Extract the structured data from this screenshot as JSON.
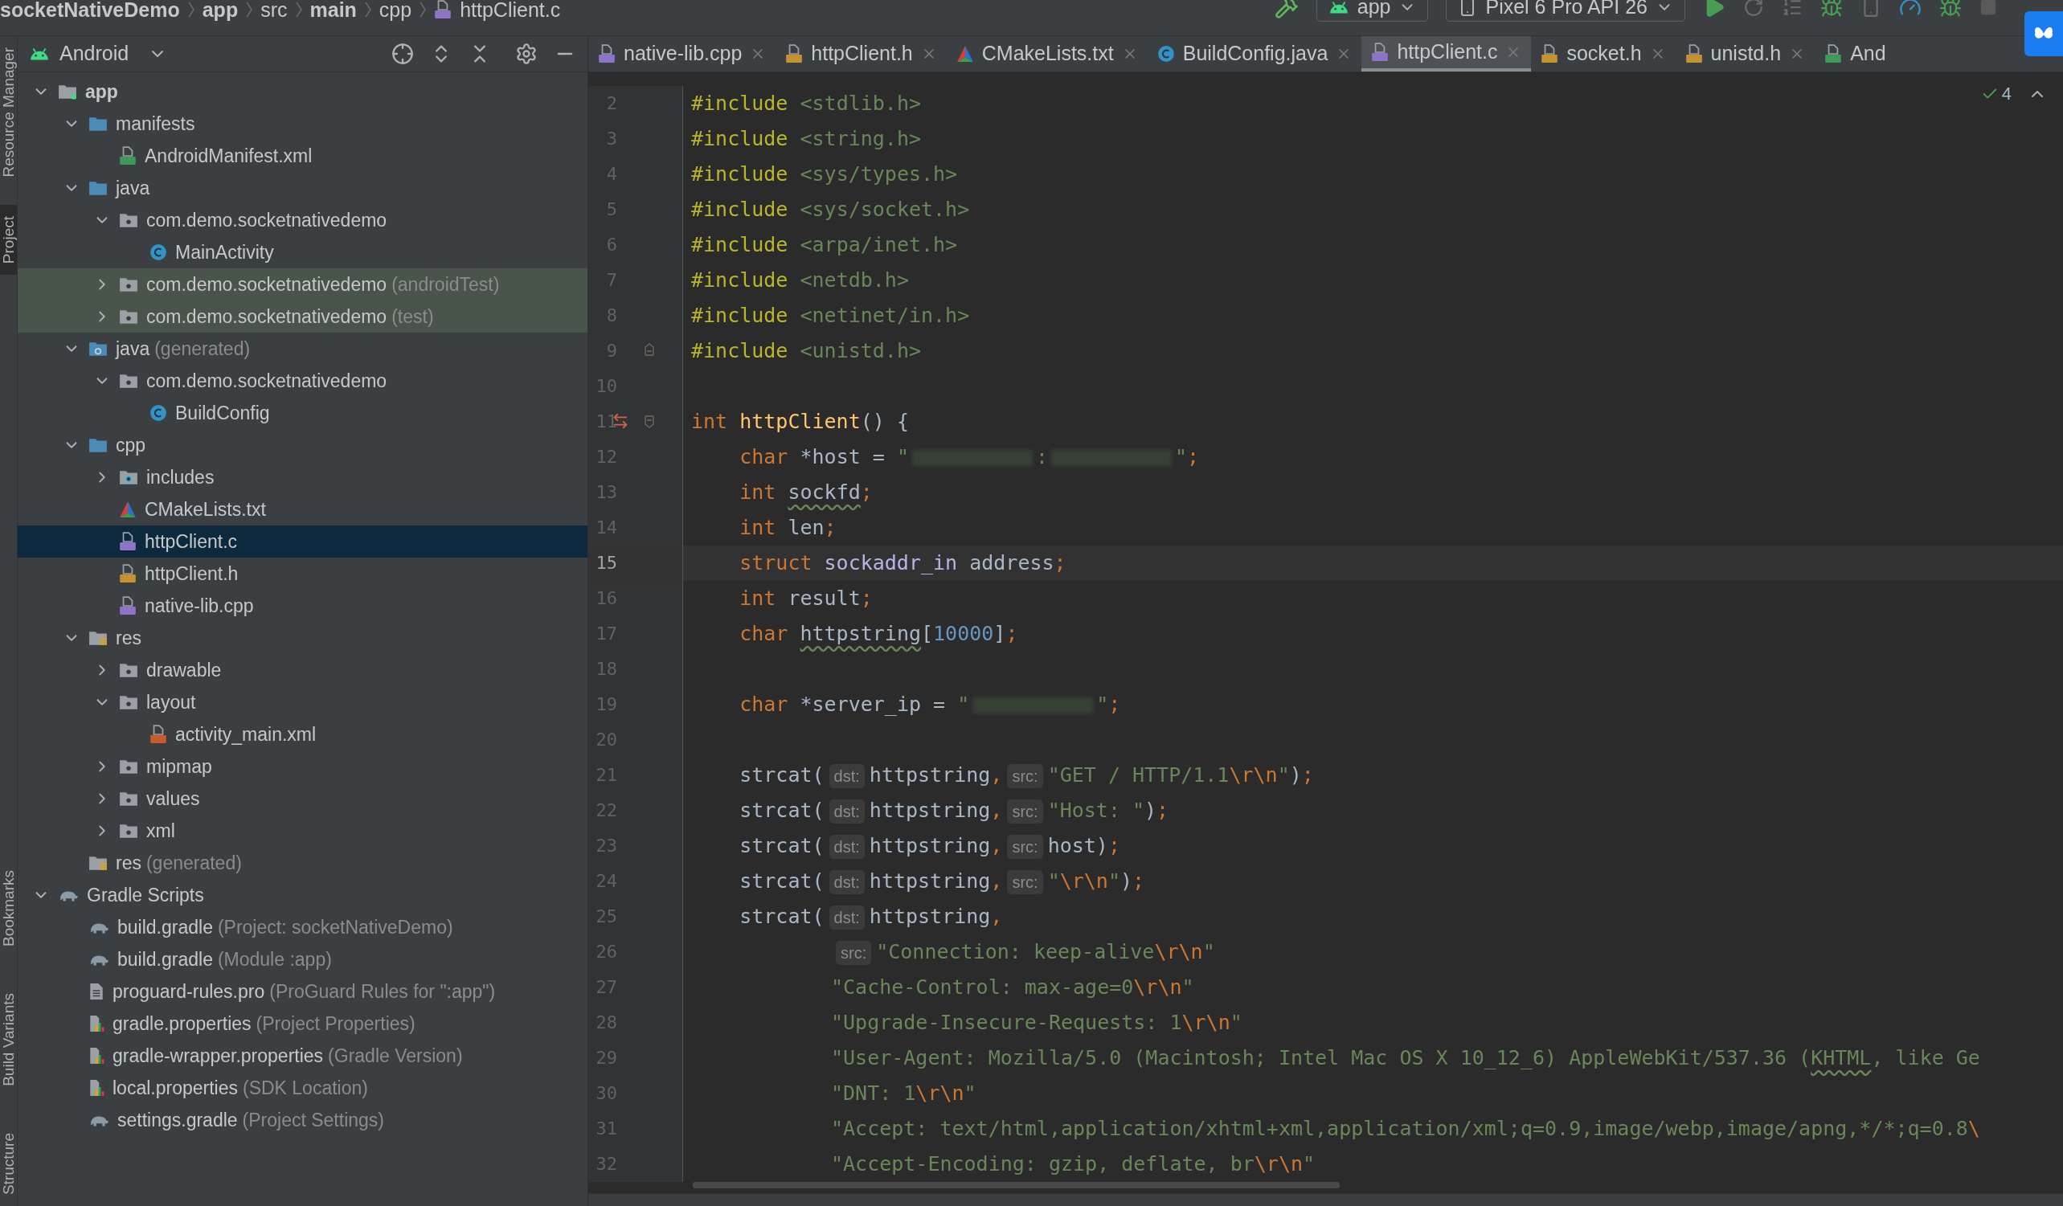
{
  "breadcrumb": [
    {
      "label": "socketNativeDemo",
      "kind": "module"
    },
    {
      "label": "app",
      "kind": "module"
    },
    {
      "label": "src",
      "kind": "folder"
    },
    {
      "label": "main",
      "kind": "module"
    },
    {
      "label": "cpp",
      "kind": "folder"
    },
    {
      "label": "httpClient.c",
      "kind": "file"
    }
  ],
  "toolbar": {
    "run_config": "app",
    "device": "Pixel 6 Pro API 26"
  },
  "tool_strip": {
    "top": [
      {
        "label": "Resource Manager",
        "selected": false
      },
      {
        "label": "Project",
        "selected": true
      }
    ],
    "bottom": [
      {
        "label": "Bookmarks",
        "selected": false
      },
      {
        "label": "Build Variants",
        "selected": false
      },
      {
        "label": "Structure",
        "selected": false
      }
    ]
  },
  "project": {
    "view": "Android",
    "tree": [
      {
        "label": "app",
        "kind": "module",
        "expanded": true,
        "selected": false,
        "children": [
          {
            "label": "manifests",
            "kind": "folder",
            "expanded": true,
            "selected": false,
            "children": [
              {
                "label": "AndroidManifest.xml",
                "kind": "manifest",
                "selected": false
              }
            ]
          },
          {
            "label": "java",
            "kind": "folder",
            "expanded": true,
            "selected": false,
            "children": [
              {
                "label": "com.demo.socketnativedemo",
                "kind": "package",
                "expanded": true,
                "selected": false,
                "children": [
                  {
                    "label": "MainActivity",
                    "kind": "class",
                    "selected": false
                  }
                ]
              },
              {
                "label": "com.demo.socketnativedemo",
                "suffix": "(androidTest)",
                "kind": "test_package",
                "expanded": false,
                "selected": false
              },
              {
                "label": "com.demo.socketnativedemo",
                "suffix": "(test)",
                "kind": "test_package",
                "expanded": false,
                "selected": false
              }
            ]
          },
          {
            "label": "java",
            "suffix": "(generated)",
            "kind": "gen_folder",
            "expanded": true,
            "selected": false,
            "children": [
              {
                "label": "com.demo.socketnativedemo",
                "kind": "package",
                "expanded": true,
                "selected": false,
                "children": [
                  {
                    "label": "BuildConfig",
                    "kind": "class",
                    "selected": false
                  }
                ]
              }
            ]
          },
          {
            "label": "cpp",
            "kind": "folder",
            "expanded": true,
            "selected": false,
            "children": [
              {
                "label": "includes",
                "kind": "includes",
                "expanded": false,
                "selected": false
              },
              {
                "label": "CMakeLists.txt",
                "kind": "cmake",
                "selected": false
              },
              {
                "label": "httpClient.c",
                "kind": "c",
                "selected": true
              },
              {
                "label": "httpClient.h",
                "kind": "h",
                "selected": false
              },
              {
                "label": "native-lib.cpp",
                "kind": "cpp",
                "selected": false
              }
            ]
          },
          {
            "label": "res",
            "kind": "res",
            "expanded": true,
            "selected": false,
            "children": [
              {
                "label": "drawable",
                "kind": "package",
                "expanded": false,
                "selected": false
              },
              {
                "label": "layout",
                "kind": "package",
                "expanded": true,
                "selected": false,
                "children": [
                  {
                    "label": "activity_main.xml",
                    "kind": "layout_xml",
                    "selected": false
                  }
                ]
              },
              {
                "label": "mipmap",
                "kind": "package",
                "expanded": false,
                "selected": false
              },
              {
                "label": "values",
                "kind": "package",
                "expanded": false,
                "selected": false
              },
              {
                "label": "xml",
                "kind": "package",
                "expanded": false,
                "selected": false
              }
            ]
          },
          {
            "label": "res",
            "suffix": "(generated)",
            "kind": "res",
            "selected": false
          }
        ]
      },
      {
        "label": "Gradle Scripts",
        "kind": "gradle",
        "expanded": true,
        "selected": false,
        "children": [
          {
            "label": "build.gradle",
            "suffix": "(Project: socketNativeDemo)",
            "kind": "gradle",
            "selected": false
          },
          {
            "label": "build.gradle",
            "suffix": "(Module :app)",
            "kind": "gradle",
            "selected": false
          },
          {
            "label": "proguard-rules.pro",
            "suffix": "(ProGuard Rules for \":app\")",
            "kind": "text",
            "selected": false
          },
          {
            "label": "gradle.properties",
            "suffix": "(Project Properties)",
            "kind": "properties",
            "selected": false
          },
          {
            "label": "gradle-wrapper.properties",
            "suffix": "(Gradle Version)",
            "kind": "properties",
            "selected": false
          },
          {
            "label": "local.properties",
            "suffix": "(SDK Location)",
            "kind": "properties",
            "selected": false
          },
          {
            "label": "settings.gradle",
            "suffix": "(Project Settings)",
            "kind": "gradle",
            "selected": false
          }
        ]
      }
    ]
  },
  "tabs": [
    {
      "label": "native-lib.cpp",
      "kind": "cpp",
      "selected": false,
      "cut": false
    },
    {
      "label": "httpClient.h",
      "kind": "h",
      "selected": false,
      "cut": false
    },
    {
      "label": "CMakeLists.txt",
      "kind": "cmake",
      "selected": false,
      "cut": false
    },
    {
      "label": "BuildConfig.java",
      "kind": "class",
      "selected": false,
      "cut": false
    },
    {
      "label": "httpClient.c",
      "kind": "c",
      "selected": true,
      "cut": false
    },
    {
      "label": "socket.h",
      "kind": "h",
      "selected": false,
      "cut": false
    },
    {
      "label": "unistd.h",
      "kind": "h",
      "selected": false,
      "cut": false
    },
    {
      "label": "And",
      "kind": "manifest",
      "selected": false,
      "cut": true
    }
  ],
  "inspection": {
    "count": "4"
  },
  "code": [
    {
      "n": "2",
      "current": false,
      "tokens": [
        {
          "kind": "directive",
          "text": "#include"
        },
        {
          "kind": "header",
          "text": " <stdlib.h>"
        }
      ]
    },
    {
      "n": "3",
      "current": false,
      "tokens": [
        {
          "kind": "directive",
          "text": "#include"
        },
        {
          "kind": "header",
          "text": " <string.h>"
        }
      ]
    },
    {
      "n": "4",
      "current": false,
      "tokens": [
        {
          "kind": "directive",
          "text": "#include"
        },
        {
          "kind": "header",
          "text": " <sys/types.h>"
        }
      ]
    },
    {
      "n": "5",
      "current": false,
      "tokens": [
        {
          "kind": "directive",
          "text": "#include"
        },
        {
          "kind": "header",
          "text": " <sys/socket.h>"
        }
      ]
    },
    {
      "n": "6",
      "current": false,
      "tokens": [
        {
          "kind": "directive",
          "text": "#include"
        },
        {
          "kind": "header",
          "text": " <arpa/inet.h>"
        }
      ]
    },
    {
      "n": "7",
      "current": false,
      "tokens": [
        {
          "kind": "directive",
          "text": "#include"
        },
        {
          "kind": "header",
          "text": " <netdb.h>"
        }
      ]
    },
    {
      "n": "8",
      "current": false,
      "tokens": [
        {
          "kind": "directive",
          "text": "#include"
        },
        {
          "kind": "header",
          "text": " <netinet/in.h>"
        }
      ]
    },
    {
      "n": "9",
      "current": false,
      "kind": "fold_end",
      "tokens": [
        {
          "kind": "directive",
          "text": "#include"
        },
        {
          "kind": "header",
          "text": " <unistd.h>"
        }
      ]
    },
    {
      "n": "10",
      "current": false
    },
    {
      "n": "11",
      "current": false,
      "kind": "fold_start_related",
      "tokens": [
        {
          "kind": "keyword",
          "text": "int"
        },
        {
          "kind": "function",
          "text": " httpClient"
        },
        {
          "kind": "text",
          "text": "() {"
        }
      ]
    },
    {
      "n": "12",
      "current": false,
      "tokens": [
        {
          "kind": "keyword",
          "text": "    char"
        },
        {
          "kind": "text",
          "text": " *host = "
        },
        {
          "kind": "string",
          "text": "\""
        },
        {
          "kind": "redacted"
        },
        {
          "kind": "string",
          "text": ":"
        },
        {
          "kind": "redacted"
        },
        {
          "kind": "string",
          "text": "\""
        },
        {
          "kind": "punct",
          "text": ";"
        }
      ]
    },
    {
      "n": "13",
      "current": false,
      "tokens": [
        {
          "kind": "keyword",
          "text": "    int "
        },
        {
          "kind": "warn",
          "text": "sockfd"
        },
        {
          "kind": "punct",
          "text": ";"
        }
      ]
    },
    {
      "n": "14",
      "current": false,
      "tokens": [
        {
          "kind": "keyword",
          "text": "    int"
        },
        {
          "kind": "text",
          "text": " len"
        },
        {
          "kind": "punct",
          "text": ";"
        }
      ]
    },
    {
      "n": "15",
      "current": true,
      "tokens": [
        {
          "kind": "keyword",
          "text": "    struct"
        },
        {
          "kind": "type",
          "text": " sockaddr_in"
        },
        {
          "kind": "text",
          "text": " address"
        },
        {
          "kind": "punct",
          "text": ";"
        }
      ]
    },
    {
      "n": "16",
      "current": false,
      "tokens": [
        {
          "kind": "keyword",
          "text": "    int"
        },
        {
          "kind": "text",
          "text": " result"
        },
        {
          "kind": "punct",
          "text": ";"
        }
      ]
    },
    {
      "n": "17",
      "current": false,
      "tokens": [
        {
          "kind": "keyword",
          "text": "    char "
        },
        {
          "kind": "warn",
          "text": "httpstring"
        },
        {
          "kind": "text",
          "text": "["
        },
        {
          "kind": "number",
          "text": "10000"
        },
        {
          "kind": "text",
          "text": "]"
        },
        {
          "kind": "punct",
          "text": ";"
        }
      ]
    },
    {
      "n": "18",
      "current": false
    },
    {
      "n": "19",
      "current": false,
      "tokens": [
        {
          "kind": "keyword",
          "text": "    char"
        },
        {
          "kind": "text",
          "text": " *server_ip = "
        },
        {
          "kind": "string",
          "text": "\""
        },
        {
          "kind": "redacted"
        },
        {
          "kind": "string",
          "text": "\""
        },
        {
          "kind": "punct",
          "text": ";"
        }
      ]
    },
    {
      "n": "20",
      "current": false
    },
    {
      "n": "21",
      "current": false,
      "tokens": [
        {
          "kind": "text",
          "text": "    strcat("
        },
        {
          "kind": "hint",
          "text": "dst:"
        },
        {
          "kind": "text",
          "text": "httpstring"
        },
        {
          "kind": "punct",
          "text": ","
        },
        {
          "kind": "hint",
          "text": "src:"
        },
        {
          "kind": "string",
          "text": "\"GET / HTTP/1.1"
        },
        {
          "kind": "escape",
          "text": "\\r\\n"
        },
        {
          "kind": "string",
          "text": "\""
        },
        {
          "kind": "text",
          "text": ")"
        },
        {
          "kind": "punct",
          "text": ";"
        }
      ]
    },
    {
      "n": "22",
      "current": false,
      "tokens": [
        {
          "kind": "text",
          "text": "    strcat("
        },
        {
          "kind": "hint",
          "text": "dst:"
        },
        {
          "kind": "text",
          "text": "httpstring"
        },
        {
          "kind": "punct",
          "text": ","
        },
        {
          "kind": "hint",
          "text": "src:"
        },
        {
          "kind": "string",
          "text": "\"Host: \""
        },
        {
          "kind": "text",
          "text": ")"
        },
        {
          "kind": "punct",
          "text": ";"
        }
      ]
    },
    {
      "n": "23",
      "current": false,
      "tokens": [
        {
          "kind": "text",
          "text": "    strcat("
        },
        {
          "kind": "hint",
          "text": "dst:"
        },
        {
          "kind": "text",
          "text": "httpstring"
        },
        {
          "kind": "punct",
          "text": ","
        },
        {
          "kind": "hint",
          "text": "src:"
        },
        {
          "kind": "text",
          "text": "host)"
        },
        {
          "kind": "punct",
          "text": ";"
        }
      ]
    },
    {
      "n": "24",
      "current": false,
      "tokens": [
        {
          "kind": "text",
          "text": "    strcat("
        },
        {
          "kind": "hint",
          "text": "dst:"
        },
        {
          "kind": "text",
          "text": "httpstring"
        },
        {
          "kind": "punct",
          "text": ","
        },
        {
          "kind": "hint",
          "text": "src:"
        },
        {
          "kind": "string",
          "text": "\""
        },
        {
          "kind": "escape",
          "text": "\\r\\n"
        },
        {
          "kind": "string",
          "text": "\""
        },
        {
          "kind": "text",
          "text": ")"
        },
        {
          "kind": "punct",
          "text": ";"
        }
      ]
    },
    {
      "n": "25",
      "current": false,
      "tokens": [
        {
          "kind": "text",
          "text": "    strcat("
        },
        {
          "kind": "hint",
          "text": "dst:"
        },
        {
          "kind": "text",
          "text": "httpstring"
        },
        {
          "kind": "punct",
          "text": ","
        }
      ]
    },
    {
      "n": "26",
      "current": false,
      "kind": "continued",
      "tokens": [
        {
          "kind": "hint",
          "text": "src:"
        },
        {
          "kind": "string",
          "text": "\"Connection: keep-alive"
        },
        {
          "kind": "escape",
          "text": "\\r\\n"
        },
        {
          "kind": "string",
          "text": "\""
        }
      ]
    },
    {
      "n": "27",
      "current": false,
      "kind": "continued",
      "tokens": [
        {
          "kind": "string",
          "text": "\"Cache-Control: max-age=0"
        },
        {
          "kind": "escape",
          "text": "\\r\\n"
        },
        {
          "kind": "string",
          "text": "\""
        }
      ]
    },
    {
      "n": "28",
      "current": false,
      "kind": "continued",
      "tokens": [
        {
          "kind": "string",
          "text": "\"Upgrade-Insecure-Requests: 1"
        },
        {
          "kind": "escape",
          "text": "\\r\\n"
        },
        {
          "kind": "string",
          "text": "\""
        }
      ]
    },
    {
      "n": "29",
      "current": false,
      "kind": "continued",
      "tokens": [
        {
          "kind": "string",
          "text": "\"User-Agent: Mozilla/5.0 (Macintosh; Intel Mac OS X 10_12_6) AppleWebKit/537.36 ("
        },
        {
          "kind": "string_warn",
          "text": "KHTML"
        },
        {
          "kind": "string",
          "text": ", like Ge"
        }
      ]
    },
    {
      "n": "30",
      "current": false,
      "kind": "continued",
      "tokens": [
        {
          "kind": "string",
          "text": "\"DNT: 1"
        },
        {
          "kind": "escape",
          "text": "\\r\\n"
        },
        {
          "kind": "string",
          "text": "\""
        }
      ]
    },
    {
      "n": "31",
      "current": false,
      "kind": "continued",
      "tokens": [
        {
          "kind": "string",
          "text": "\"Accept: text/html,application/xhtml+xml,application/xml;q=0.9,image/webp,image/apng,*/*;q=0.8"
        },
        {
          "kind": "escape",
          "text": "\\"
        }
      ]
    },
    {
      "n": "32",
      "current": false,
      "kind": "continued",
      "tokens": [
        {
          "kind": "string",
          "text": "\"Accept-Encoding: gzip, deflate, br"
        },
        {
          "kind": "escape",
          "text": "\\r\\n"
        },
        {
          "kind": "string",
          "text": "\""
        }
      ]
    }
  ]
}
